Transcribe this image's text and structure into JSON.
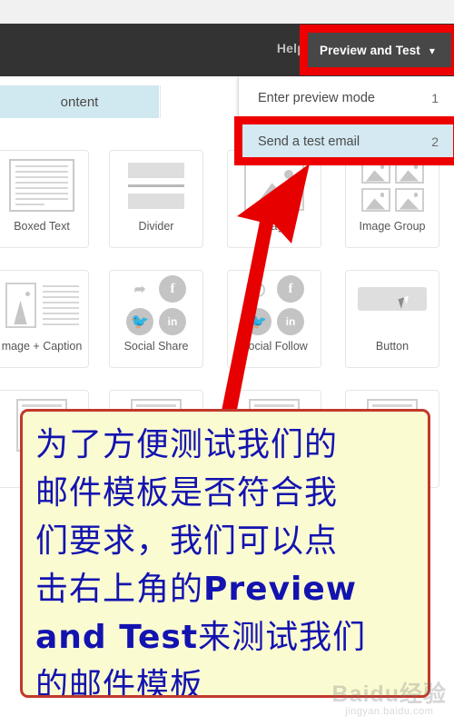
{
  "header": {
    "help_label": "Help",
    "preview_button_label": "Preview and Test",
    "chevron_icon": "chevron-down-icon",
    "background_color": "#333333",
    "button_color": "#474747"
  },
  "tabs": {
    "content_tab_label": "ontent",
    "content_tab_color": "#d0e8f0"
  },
  "dropdown": {
    "items": [
      {
        "label": "Enter preview mode",
        "shortcut": "1",
        "selected": false
      },
      {
        "label": "Send a test email",
        "shortcut": "2",
        "selected": true
      }
    ],
    "highlight_color": "#d4e9f1"
  },
  "blocks": {
    "tiles": [
      {
        "label": "Boxed Text",
        "icon": "boxed-text-icon"
      },
      {
        "label": "Divider",
        "icon": "divider-icon"
      },
      {
        "label": "Image",
        "icon": "image-icon"
      },
      {
        "label": "Image Group",
        "icon": "image-group-icon"
      },
      {
        "label": "mage + Caption",
        "icon": "image-caption-icon"
      },
      {
        "label": "Social Share",
        "icon": "social-share-icon"
      },
      {
        "label": "Social Follow",
        "icon": "social-follow-icon"
      },
      {
        "label": "Button",
        "icon": "button-icon"
      }
    ],
    "social_share_icons": [
      "share-icon",
      "facebook-icon",
      "twitter-icon",
      "linkedin-icon"
    ],
    "social_follow_icons": [
      "circle-icon",
      "facebook-icon",
      "twitter-icon",
      "linkedin-icon"
    ]
  },
  "annotations": {
    "rect_color": "#ee0000",
    "arrow_color": "#e60000",
    "note": {
      "border_color": "#c0392b",
      "background_color": "#fbfbd2",
      "text_color": "#1313b0",
      "line1": "为了方便测试我们的",
      "line2": "邮件模板是否符合我",
      "line3": "们要求，我们可以点",
      "line4_prefix": "击右上角的",
      "line4_bold": "Preview",
      "line5_bold": "and Test",
      "line5_suffix": "来测试我们",
      "line6": "的邮件模板"
    }
  },
  "watermark": {
    "main": "Baidu经验",
    "sub": "jingyan.baidu.com"
  }
}
